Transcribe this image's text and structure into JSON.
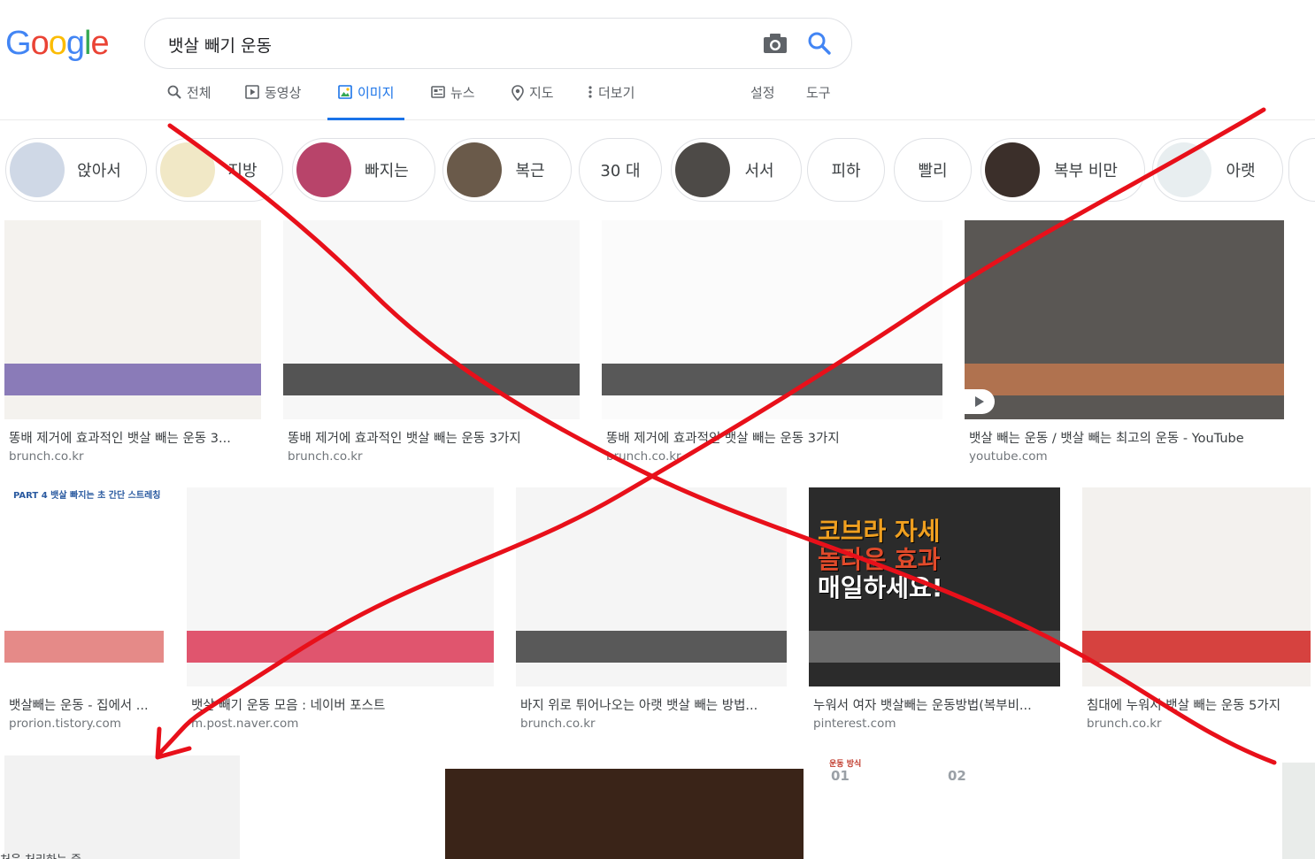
{
  "logo": [
    "G",
    "o",
    "o",
    "g",
    "l",
    "e"
  ],
  "colors": {
    "logo": [
      "#4285F4",
      "#EA4335",
      "#FBBC05",
      "#4285F4",
      "#34A853",
      "#EA4335"
    ],
    "accent": "#1a73e8",
    "annotation": "#e8101a"
  },
  "search": {
    "query": "뱃살 빼기 운동"
  },
  "tabs": [
    {
      "label": "전체",
      "icon": "search-icon"
    },
    {
      "label": "동영상",
      "icon": "video-icon"
    },
    {
      "label": "이미지",
      "icon": "image-icon",
      "active": true
    },
    {
      "label": "뉴스",
      "icon": "news-icon"
    },
    {
      "label": "지도",
      "icon": "map-pin-icon"
    },
    {
      "label": "더보기",
      "icon": "more-vert-icon"
    },
    {
      "label": "설정"
    },
    {
      "label": "도구"
    }
  ],
  "chips": [
    {
      "label": "앉아서"
    },
    {
      "label": "지방"
    },
    {
      "label": "빠지는"
    },
    {
      "label": "복근"
    },
    {
      "label": "30 대"
    },
    {
      "label": "서서"
    },
    {
      "label": "피하"
    },
    {
      "label": "빨리"
    },
    {
      "label": "복부 비만"
    },
    {
      "label": "아랫"
    }
  ],
  "results": [
    {
      "title": "똥배 제거에 효과적인 뱃살 빼는 운동 3...",
      "source": "brunch.co.kr"
    },
    {
      "title": "똥배 제거에 효과적인 뱃살 빼는 운동 3가지",
      "source": "brunch.co.kr"
    },
    {
      "title": "똥배 제거에 효과적인 뱃살 빼는 운동 3가지",
      "source": "brunch.co.kr"
    },
    {
      "title": "뱃살 빼는 운동 / 뱃살 빼는 최고의 운동 - YouTube",
      "source": "youtube.com"
    },
    {
      "title": "뱃살빼는 운동 - 집에서 ...",
      "source": "prorion.tistory.com"
    },
    {
      "title": "뱃살 빼기 운동 모음 : 네이버 포스트",
      "source": "m.post.naver.com"
    },
    {
      "title": "바지 위로 튀어나오는 아랫 뱃살 빼는 방법...",
      "source": "brunch.co.kr"
    },
    {
      "title": "누워서 여자 뱃살빼는 운동방법(복부비...",
      "source": "pinterest.com"
    },
    {
      "title": "침대에 누워서 뱃살 빼는 운동 5가지",
      "source": "brunch.co.kr"
    }
  ],
  "image_text": {
    "infographic_header": "PART 4 뱃살 빠지는 초 간단 스트레칭",
    "cobra_line1": "코브라 자세",
    "cobra_line2": "놀라운 효과",
    "cobra_line3": "매일하세요!",
    "step1": "01",
    "step2": "02",
    "step_header": "운동 방식"
  },
  "bottom_caption": "처음 처리하는 중"
}
